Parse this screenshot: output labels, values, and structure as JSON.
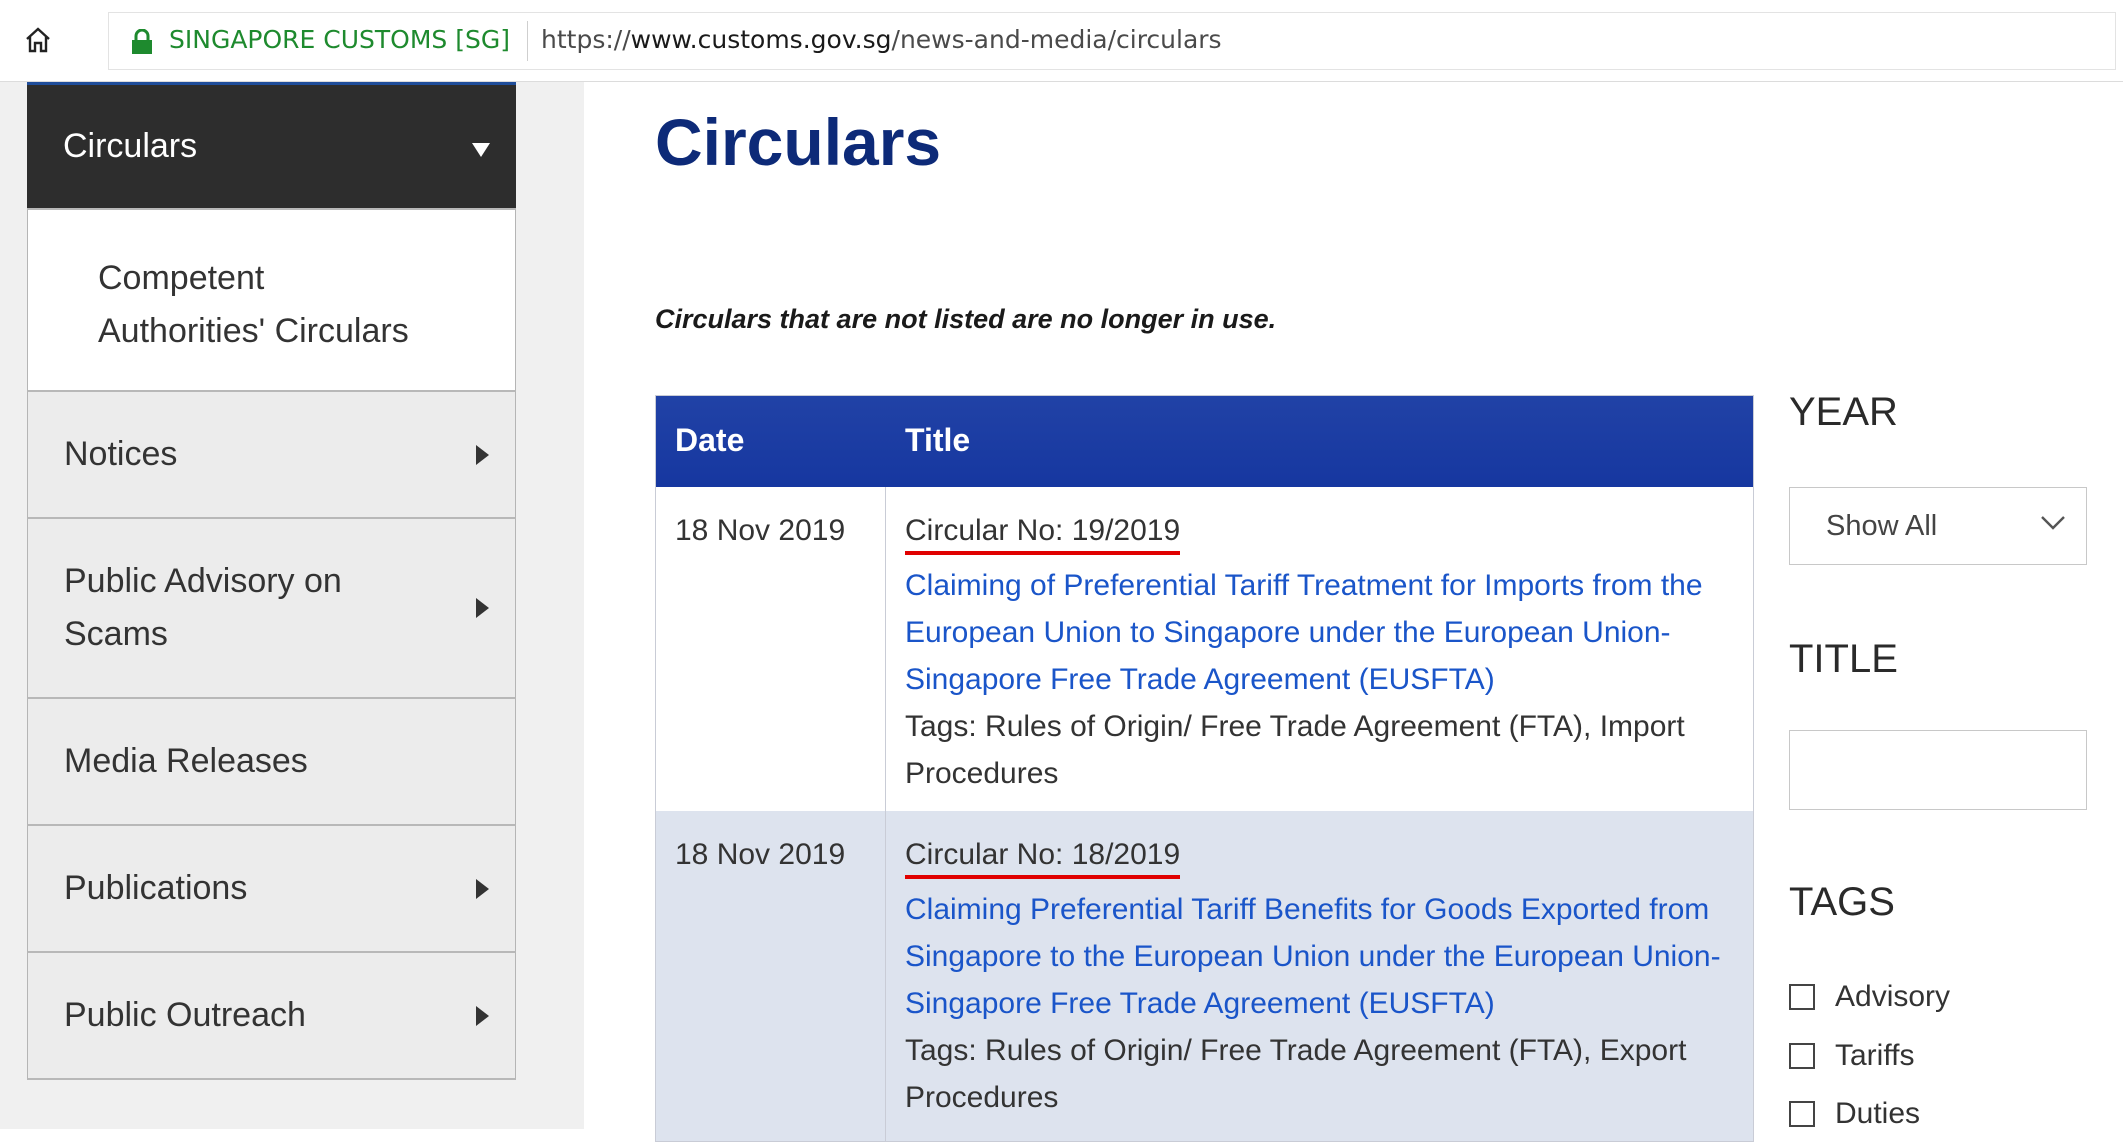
{
  "browser": {
    "site_identity": "SINGAPORE CUSTOMS [SG]",
    "url_prefix": "https://",
    "url_domain": "www.customs.gov.sg",
    "url_path": "/news-and-media/circulars"
  },
  "sidebar": {
    "active": "Circulars",
    "sub_item": "Competent Authorities' Circulars",
    "items": [
      {
        "label": "Notices"
      },
      {
        "label": "Public Advisory on Scams"
      },
      {
        "label": "Media Releases"
      },
      {
        "label": "Publications"
      },
      {
        "label": "Public Outreach"
      }
    ]
  },
  "main": {
    "title": "Circulars",
    "notice": "Circulars that are not listed are no longer in use.",
    "table": {
      "headers": {
        "date": "Date",
        "title": "Title"
      },
      "rows": [
        {
          "date": "18 Nov 2019",
          "circular_no": "Circular No: 19/2019",
          "link": "Claiming of Preferential Tariff Treatment for Imports from the European Union to Singapore under the European Union-Singapore Free Trade Agreement (EUSFTA)",
          "tags": "Tags: Rules of Origin/ Free Trade Agreement (FTA), Import Procedures"
        },
        {
          "date": "18 Nov 2019",
          "circular_no": "Circular No: 18/2019",
          "link": "Claiming Preferential Tariff Benefits for Goods Exported from Singapore to the European Union under the European Union-Singapore Free Trade Agreement (EUSFTA)",
          "tags": "Tags: Rules of Origin/ Free Trade Agreement (FTA), Export Procedures"
        }
      ]
    }
  },
  "filters": {
    "year_heading": "YEAR",
    "year_value": "Show All",
    "title_heading": "TITLE",
    "title_value": "",
    "tags_heading": "TAGS",
    "tags": [
      {
        "label": "Advisory",
        "checked": false
      },
      {
        "label": "Tariffs",
        "checked": false
      },
      {
        "label": "Duties",
        "checked": false
      }
    ]
  },
  "colors": {
    "accent_blue": "#1637a0",
    "title_navy": "#0d2a78",
    "link_blue": "#1a55c9",
    "secure_green": "#1e8a2e",
    "annotation_red": "#e00000"
  }
}
